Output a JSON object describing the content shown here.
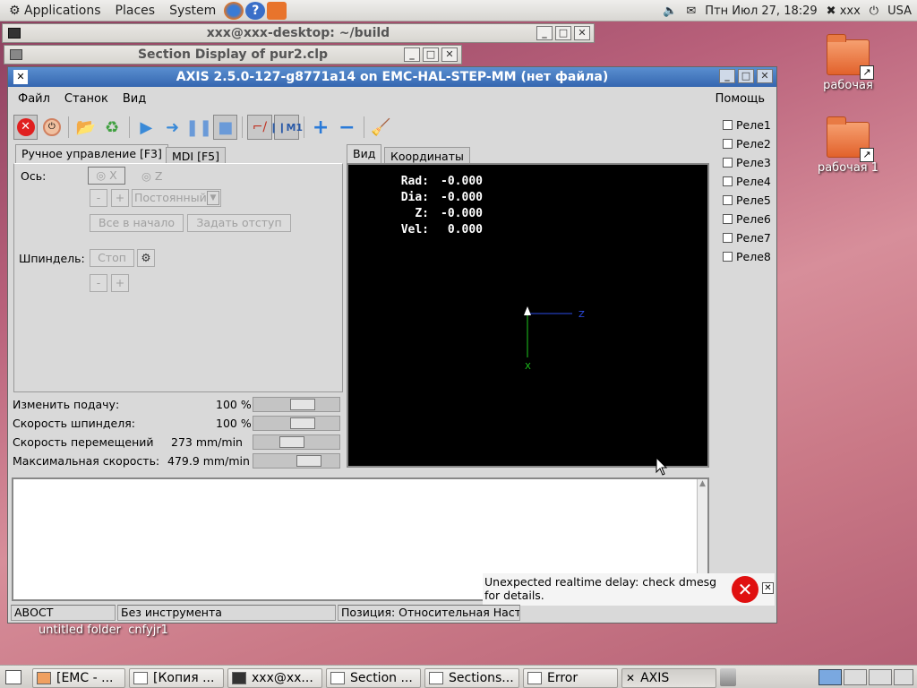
{
  "top_panel": {
    "menus": [
      "Applications",
      "Places",
      "System"
    ],
    "datetime": "Птн Июл 27, 18:29",
    "user": "xxx",
    "keyboard": "USA"
  },
  "desktop": {
    "icons": [
      "рабочая",
      "рабочая 1"
    ],
    "folder_labels": [
      "untitled folder",
      "cnfyjr1"
    ]
  },
  "terminal_window": {
    "title": "xxx@xxx-desktop: ~/build"
  },
  "section_window": {
    "title": "Section Display of pur2.clp"
  },
  "axis": {
    "title": "AXIS 2.5.0-127-g8771a14 on EMC-HAL-STEP-MM (нет файла)",
    "menu": [
      "Файл",
      "Станок",
      "Вид"
    ],
    "help": "Помощь",
    "tabs_left": [
      "Ручное управление [F3]",
      "MDI [F5]"
    ],
    "tabs_right": [
      "Вид",
      "Координаты"
    ],
    "manual": {
      "axis_label": "Ось:",
      "axis_x": "X",
      "axis_z": "Z",
      "minus": "-",
      "plus": "+",
      "jog_mode": "Постоянный",
      "home_all": "Все в начало",
      "touch_off": "Задать отступ",
      "spindle_label": "Шпиндель:",
      "spindle_stop": "Стоп"
    },
    "overrides": [
      {
        "label": "Изменить подачу:",
        "value": "100 %",
        "fraction": 0.6
      },
      {
        "label": "Скорость шпинделя:",
        "value": "100 %",
        "fraction": 0.6
      },
      {
        "label": "Скорость перемещений",
        "value": "273 mm/min",
        "fraction": 0.42
      },
      {
        "label": "Максимальная скорость:",
        "value": "479.9 mm/min",
        "fraction": 0.7
      }
    ],
    "dro": [
      {
        "label": "Rad:",
        "value": "-0.000"
      },
      {
        "label": "Dia:",
        "value": "-0.000"
      },
      {
        "label": "Z:",
        "value": "-0.000"
      },
      {
        "label": "Vel:",
        "value": "0.000"
      }
    ],
    "axes_labels": {
      "z": "Z",
      "x": "X"
    },
    "relays": [
      "Реле1",
      "Реле2",
      "Реле3",
      "Реле4",
      "Реле5",
      "Реле6",
      "Реле7",
      "Реле8"
    ],
    "status": {
      "state": "АВОСТ",
      "tool": "Без инструмента",
      "position": "Позиция: Относительная Насто"
    },
    "error": "Unexpected realtime delay: check dmesg for details."
  },
  "taskbar": [
    "[EMC - ...",
    "[Копия ...",
    "xxx@xx...",
    "Section ...",
    "Sections...",
    "Error",
    "AXIS"
  ],
  "colors": {
    "title_active": "#3566b0",
    "dro_bg": "#000000",
    "error_red": "#e01010"
  }
}
